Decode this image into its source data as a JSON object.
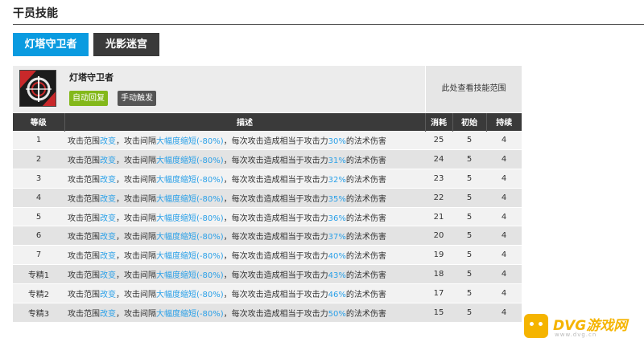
{
  "section": {
    "title": "干员技能"
  },
  "tabs": [
    {
      "label": "灯塔守卫者",
      "active": true
    },
    {
      "label": "光影迷宫",
      "active": false
    }
  ],
  "skill": {
    "name": "灯塔守卫者",
    "recovery_badge": "自动回复",
    "trigger_badge": "手动触发",
    "range_hint": "此处查看技能范围"
  },
  "table": {
    "headers": [
      "等级",
      "描述",
      "消耗",
      "初始",
      "持续"
    ],
    "desc_parts": {
      "p1": "攻击范围",
      "h1": "改变",
      "p2": "，攻击间隔",
      "h2": "大幅度缩短(-80%)",
      "p3": "，每次攻击造成相当于攻击力",
      "p4": "的法术伤害"
    },
    "rows": [
      {
        "level": "1",
        "pct": "30%",
        "cost": "25",
        "init": "5",
        "dur": "4"
      },
      {
        "level": "2",
        "pct": "31%",
        "cost": "24",
        "init": "5",
        "dur": "4"
      },
      {
        "level": "3",
        "pct": "32%",
        "cost": "23",
        "init": "5",
        "dur": "4"
      },
      {
        "level": "4",
        "pct": "35%",
        "cost": "22",
        "init": "5",
        "dur": "4"
      },
      {
        "level": "5",
        "pct": "36%",
        "cost": "21",
        "init": "5",
        "dur": "4"
      },
      {
        "level": "6",
        "pct": "37%",
        "cost": "20",
        "init": "5",
        "dur": "4"
      },
      {
        "level": "7",
        "pct": "40%",
        "cost": "19",
        "init": "5",
        "dur": "4"
      },
      {
        "level": "专精1",
        "pct": "43%",
        "cost": "18",
        "init": "5",
        "dur": "4"
      },
      {
        "level": "专精2",
        "pct": "46%",
        "cost": "17",
        "init": "5",
        "dur": "4"
      },
      {
        "level": "专精3",
        "pct": "50%",
        "cost": "15",
        "init": "5",
        "dur": "4"
      }
    ]
  },
  "watermark": {
    "brand": "DVG游戏网",
    "sub": "www.dvg.cn"
  },
  "colors": {
    "accent": "#0a9be0",
    "highlight": "#2aa0e8",
    "auto_badge": "#83b81a",
    "header_dark": "#3a3a3a"
  }
}
